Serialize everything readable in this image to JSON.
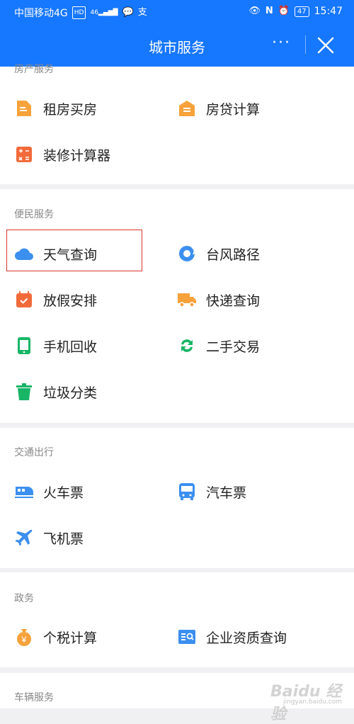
{
  "status_bar": {
    "carrier": "中国移动4G",
    "hd": "HD",
    "network": "46",
    "battery": "47",
    "time": "15:47"
  },
  "nav": {
    "title": "城市服务",
    "more": "···"
  },
  "sections": {
    "housing": {
      "title": "房产服务",
      "items": [
        "租房买房",
        "房贷计算",
        "装修计算器"
      ]
    },
    "convenience": {
      "title": "便民服务",
      "items": [
        "天气查询",
        "台风路径",
        "放假安排",
        "快递查询",
        "手机回收",
        "二手交易",
        "垃圾分类"
      ]
    },
    "transport": {
      "title": "交通出行",
      "items": [
        "火车票",
        "汽车票",
        "飞机票"
      ]
    },
    "government": {
      "title": "政务",
      "items": [
        "个税计算",
        "企业资质查询"
      ]
    },
    "vehicle": {
      "title": "车辆服务"
    }
  },
  "icon_colors": {
    "orange": "#f7a23b",
    "red_orange": "#f26a3a",
    "blue": "#3b8fef",
    "green": "#18b566"
  },
  "watermark": {
    "main": "Baidu 经验",
    "sub": "jingyan.baidu.com"
  }
}
